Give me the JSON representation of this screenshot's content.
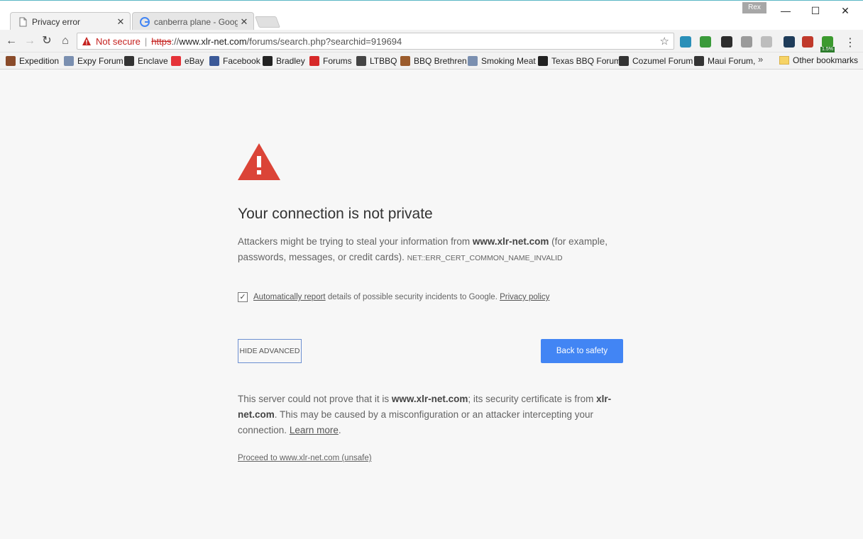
{
  "tabs": [
    {
      "title": "Privacy error",
      "close": "✕"
    },
    {
      "title": "canberra plane - Google",
      "close": "✕"
    }
  ],
  "profile": "Rex",
  "window_controls": {
    "minimize": "—",
    "maximize": "☐",
    "close": "✕"
  },
  "toolbar": {
    "not_secure": "Not secure",
    "separator": "|",
    "url_scheme": "https",
    "url_scheme_rest": "://",
    "url_host": "www.xlr-net.com",
    "url_path": "/forums/search.php?searchid=919694",
    "star": "☆",
    "menu": "⋮",
    "extensions": [
      {
        "icon": "extension-1-icon",
        "color": "#2a8fb8"
      },
      {
        "icon": "extension-2-icon",
        "color": "#3a9a3a"
      },
      {
        "icon": "extension-3-icon",
        "color": "#2d2d2d"
      },
      {
        "icon": "extension-4-icon",
        "color": "#9a9a9a"
      },
      {
        "icon": "extension-5-icon",
        "color": "#bdbdbd"
      },
      {
        "icon": "extension-6-icon",
        "color": "#1f3c5a"
      },
      {
        "icon": "extension-7-icon",
        "color": "#c0392b"
      },
      {
        "icon": "extension-8-icon",
        "color": "#3c9a2f"
      }
    ],
    "extension_badge": "1.5%"
  },
  "bookmarks": [
    {
      "label": "Expedition",
      "color": "#8a4b2a"
    },
    {
      "label": "Expy Forum",
      "color": "#7a8fb0"
    },
    {
      "label": "Enclave",
      "color": "#333333"
    },
    {
      "label": "eBay",
      "color": "#e53238"
    },
    {
      "label": "Facebook",
      "color": "#3b5998"
    },
    {
      "label": "Bradley",
      "color": "#222222"
    },
    {
      "label": "Forums",
      "color": "#d62828"
    },
    {
      "label": "LTBBQ",
      "color": "#444444"
    },
    {
      "label": "BBQ Brethren",
      "color": "#9b5b2b"
    },
    {
      "label": "Smoking Meat",
      "color": "#7a8fb0"
    },
    {
      "label": "Texas BBQ Forum",
      "color": "#222222"
    },
    {
      "label": "Cozumel Forum",
      "color": "#333333"
    },
    {
      "label": "Maui Forum,",
      "color": "#333333"
    }
  ],
  "bookmarks_more": "»",
  "bookmarks_other": "Other bookmarks",
  "interstitial": {
    "heading": "Your connection is not private",
    "p1_before": "Attackers might be trying to steal your information from ",
    "p1_host": "www.xlr-net.com",
    "p1_after": " (for example, passwords, messages, or credit cards). ",
    "error_code": "NET::ERR_CERT_COMMON_NAME_INVALID",
    "checkbox_mark": "✓",
    "report_link": "Automatically report",
    "report_text": " details of possible security incidents to Google. ",
    "privacy_link": "Privacy policy",
    "hide_advanced": "HIDE ADVANCED",
    "back_to_safety": "Back to safety",
    "p2_a": "This server could not prove that it is ",
    "p2_host": "www.xlr-net.com",
    "p2_b": "; its security certificate is from ",
    "p2_issuer": "xlr-net.com",
    "p2_c": ". This may be caused by a misconfiguration or an attacker intercepting your connection. ",
    "learn_more": "Learn more",
    "p2_d": ".",
    "proceed": "Proceed to www.xlr-net.com (unsafe)"
  }
}
